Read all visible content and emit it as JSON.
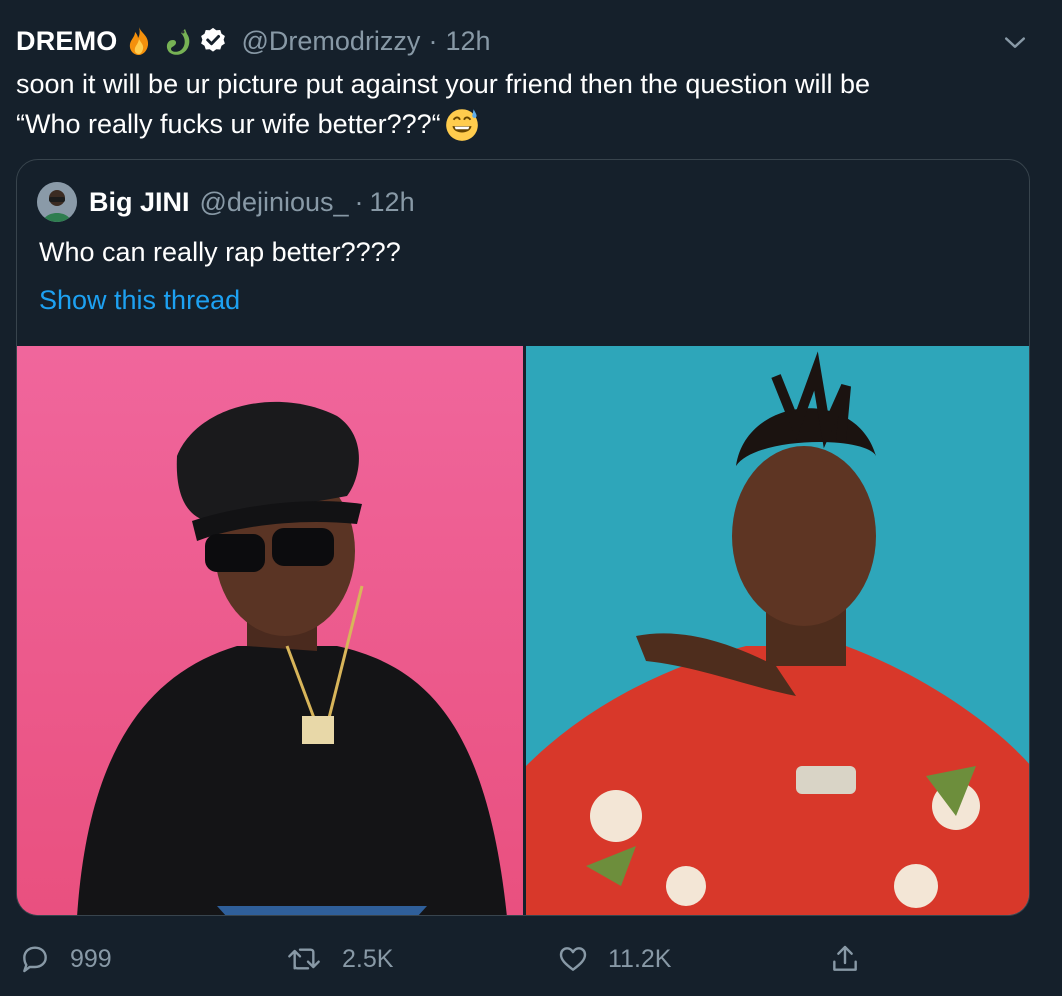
{
  "tweet": {
    "author": {
      "name": "DREMO",
      "emojis": [
        "fire-emoji",
        "dragon-emoji"
      ],
      "verified": true,
      "handle": "@Dremodrizzy",
      "separator": "·",
      "time": "12h"
    },
    "text_line1": "soon it will be ur picture put against your friend then the question will be",
    "text_line2": "“Who really fucks ur wife better???“",
    "text_emoji": "grinning-sweat-emoji"
  },
  "quote": {
    "author": {
      "name": "Big JINI",
      "handle": "@dejinious_",
      "separator": "·",
      "time": "12h"
    },
    "text": "Who can really rap better????",
    "thread_link": "Show this thread",
    "media": [
      {
        "alt_icon": "photo-left",
        "background": "#ef5b92"
      },
      {
        "alt_icon": "photo-right",
        "background": "#2fa2b6"
      }
    ]
  },
  "actions": {
    "reply_count": "999",
    "retweet_count": "2.5K",
    "like_count": "11.2K"
  },
  "colors": {
    "background": "#15202b",
    "muted": "#8899a6",
    "link": "#1da1f2",
    "border": "#38444d"
  }
}
